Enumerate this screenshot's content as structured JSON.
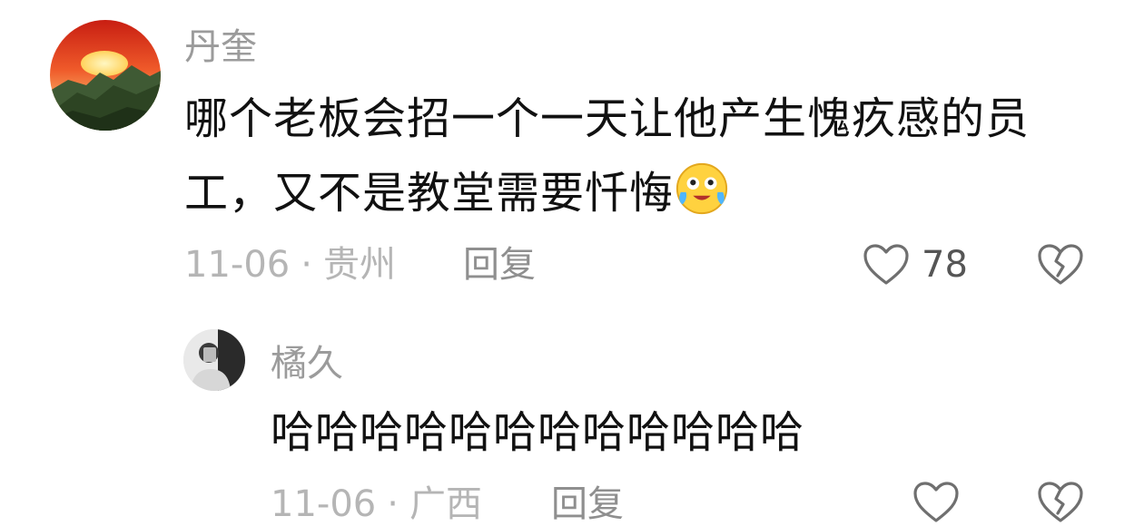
{
  "comment": {
    "username": "丹奎",
    "text": "哪个老板会招一个一天让他产生愧疚感的员工，又不是教堂需要忏悔",
    "emoji": "crying-laughing-emoji",
    "date": "11-06",
    "separator": "·",
    "location": "贵州",
    "reply_label": "回复",
    "likes": "78"
  },
  "reply": {
    "username": "橘久",
    "text": "哈哈哈哈哈哈哈哈哈哈哈哈",
    "date": "11-06",
    "separator": "·",
    "location": "广西",
    "reply_label": "回复"
  },
  "colors": {
    "username": "#9b9b9b",
    "text": "#111111",
    "meta": "#b5b5b5",
    "icon": "#6f6f6f"
  }
}
